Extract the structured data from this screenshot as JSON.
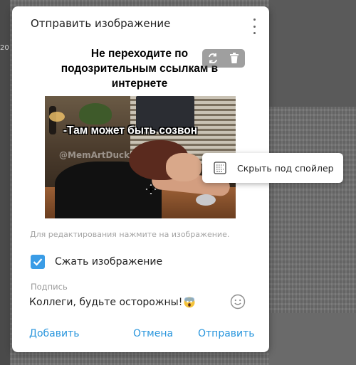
{
  "background": {
    "left_label": "20"
  },
  "dialog": {
    "title": "Отправить изображение",
    "menu_icon": "more-vertical-icon",
    "image": {
      "meme_caption": "Не переходите по подозрительным ссылкам в интернете",
      "photo_text": "-Там может быть созвон",
      "watermark": "@MemArtDuck",
      "toolbar_icons": [
        "replace-icon",
        "delete-icon"
      ]
    },
    "hint": "Для редактирования нажмите на изображение.",
    "compress": {
      "label": "Сжать изображение",
      "checked": true
    },
    "caption": {
      "label": "Подпись",
      "value": "Коллеги, будьте осторожны!",
      "emoji_icon": "smile-icon"
    },
    "footer": {
      "add_label": "Добавить",
      "cancel_label": "Отмена",
      "send_label": "Отправить"
    }
  },
  "context_menu": {
    "items": [
      {
        "label": "Скрыть под спойлер",
        "icon": "spoiler-icon"
      }
    ]
  },
  "colors": {
    "accent": "#2996dd",
    "checkbox": "#3a9ce6"
  }
}
